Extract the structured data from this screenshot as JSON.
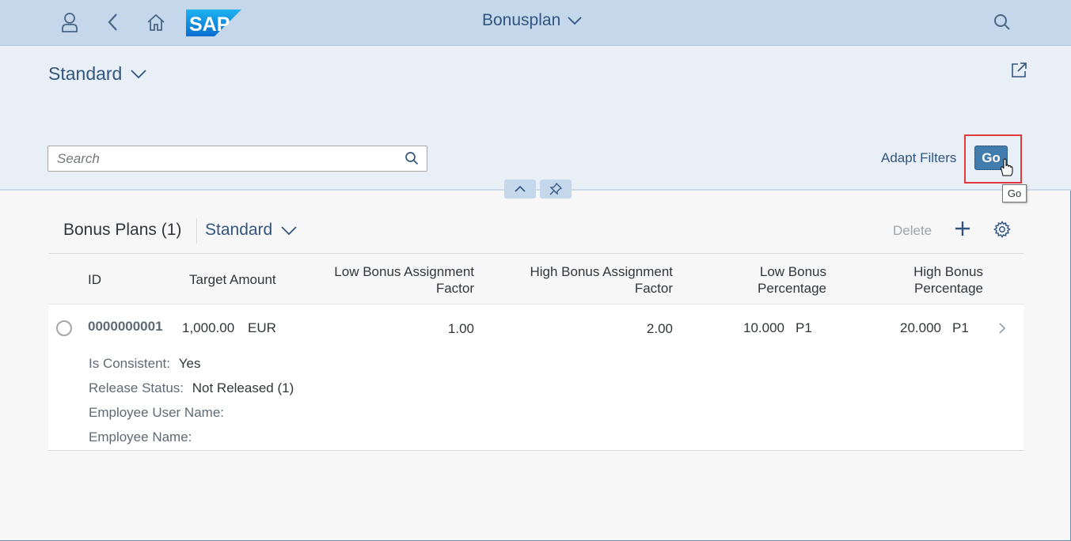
{
  "shell": {
    "title": "Bonusplan",
    "logo_text": "SAP",
    "icons": [
      "user-icon",
      "back-icon",
      "home-icon",
      "search-icon"
    ]
  },
  "header": {
    "variant": "Standard",
    "search_placeholder": "Search",
    "adapt_filters": "Adapt Filters",
    "go": "Go",
    "go_tooltip": "Go"
  },
  "table": {
    "title": "Bonus Plans (1)",
    "variant": "Standard",
    "delete": "Delete",
    "columns": {
      "id": "ID",
      "target_amount": "Target Amount",
      "low_factor": [
        "Low Bonus Assignment",
        "Factor"
      ],
      "high_factor": [
        "High Bonus Assignment",
        "Factor"
      ],
      "low_pct": [
        "Low Bonus",
        "Percentage"
      ],
      "high_pct": [
        "High Bonus",
        "Percentage"
      ]
    },
    "rows": [
      {
        "id": "0000000001",
        "target_amount": "1,000.00",
        "currency": "EUR",
        "low_factor": "1.00",
        "high_factor": "2.00",
        "low_pct": "10.000",
        "low_pct_unit": "P1",
        "high_pct": "20.000",
        "high_pct_unit": "P1",
        "details": {
          "consistent_label": "Is Consistent:",
          "consistent_value": "Yes",
          "release_label": "Release Status:",
          "release_value": "Not Released (1)",
          "user_label": "Employee User Name:",
          "user_value": "",
          "name_label": "Employee Name:",
          "name_value": ""
        }
      }
    ]
  },
  "colors": {
    "shell_bg": "#c4d7eb",
    "header_bg": "#e8eff6",
    "accent": "#32557f",
    "go_button": "#427cac",
    "highlight": "#e0393e"
  }
}
